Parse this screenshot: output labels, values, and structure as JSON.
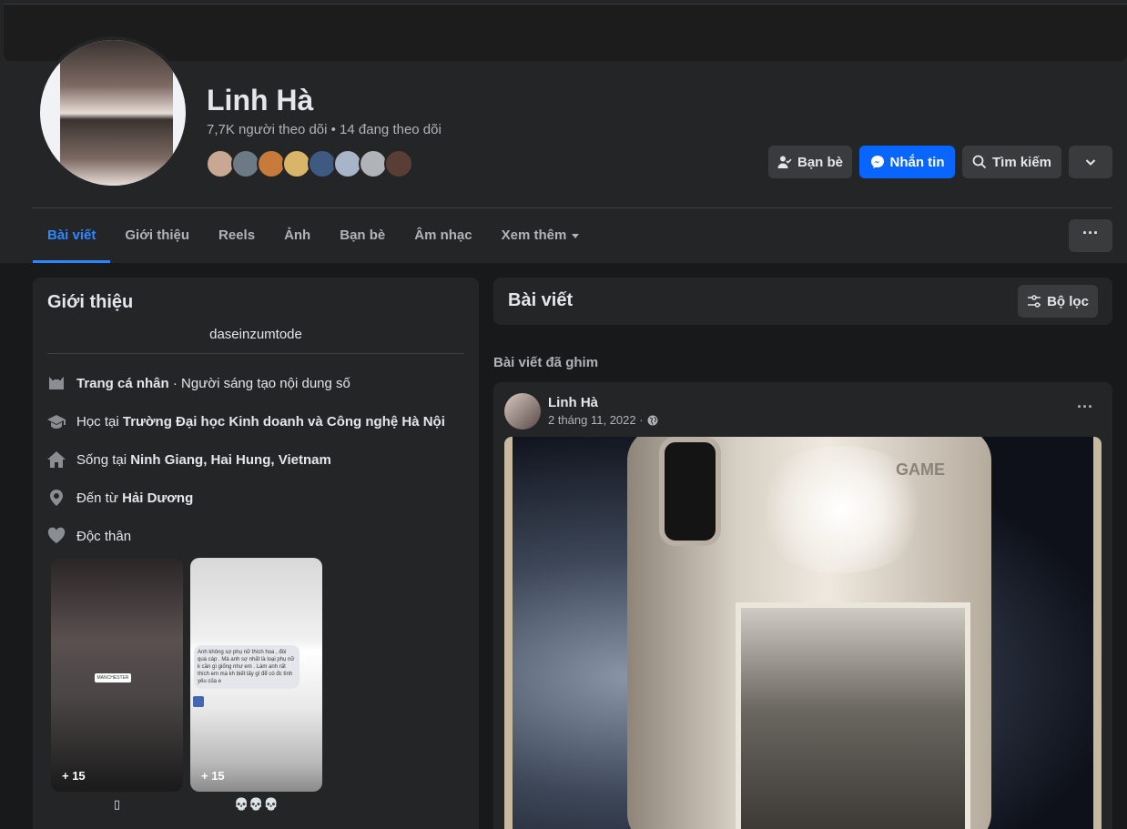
{
  "profile": {
    "name": "Linh Hà",
    "followers_text": "7,7K người theo dõi • 14 đang theo dõi"
  },
  "friend_avatars": [
    "#c9a893",
    "#6b7a84",
    "#c77a3a",
    "#d9b56a",
    "#3f5a82",
    "#a8b4c8",
    "#b0b3b8",
    "#5a3d35"
  ],
  "actions": {
    "friends_label": "Bạn bè",
    "message_label": "Nhắn tin",
    "search_label": "Tìm kiếm"
  },
  "tabs": [
    {
      "label": "Bài viết"
    },
    {
      "label": "Giới thiệu"
    },
    {
      "label": "Reels"
    },
    {
      "label": "Ảnh"
    },
    {
      "label": "Bạn bè"
    },
    {
      "label": "Âm nhạc"
    },
    {
      "label": "Xem thêm"
    }
  ],
  "intro": {
    "title": "Giới thiệu",
    "bio": "daseinzumtode",
    "items": [
      {
        "prefix": "",
        "bold": "Trang cá nhân",
        "suffix": " · Người sáng tạo nội dung số"
      },
      {
        "prefix": "Học tại ",
        "bold": "Trường Đại học Kinh doanh và Công nghệ Hà Nội",
        "suffix": ""
      },
      {
        "prefix": "Sống tại ",
        "bold": "Ninh Giang, Hai Hung, Vietnam",
        "suffix": ""
      },
      {
        "prefix": "Đến từ ",
        "bold": "Hải Dương",
        "suffix": ""
      },
      {
        "prefix": "",
        "bold": "",
        "suffix": "Độc thân"
      }
    ],
    "highlights": [
      {
        "count": "+ 15",
        "label": "▯",
        "tag": "MANCHESTER"
      },
      {
        "count": "+ 15",
        "label": "💀💀💀",
        "chat": "Anh không sợ phụ nữ thích hoa , đòi quà cáp . Mà anh sợ nhất là loại phụ nữ k cần gì giống như em . Làm anh rất thích em mà kh biết lấy gì để có đc tình yêu của e"
      }
    ]
  },
  "posts": {
    "title": "Bài viết",
    "filter_label": "Bộ lọc",
    "pinned_label": "Bài viết đã ghim",
    "post": {
      "author": "Linh Hà",
      "date": "2 tháng 11, 2022 ·",
      "photo_text": "GAME"
    }
  },
  "colors": {
    "accent": "#2d88ff",
    "messenger": "#0866ff",
    "background": "#18191a",
    "surface": "#242526",
    "button": "#3a3b3c"
  }
}
